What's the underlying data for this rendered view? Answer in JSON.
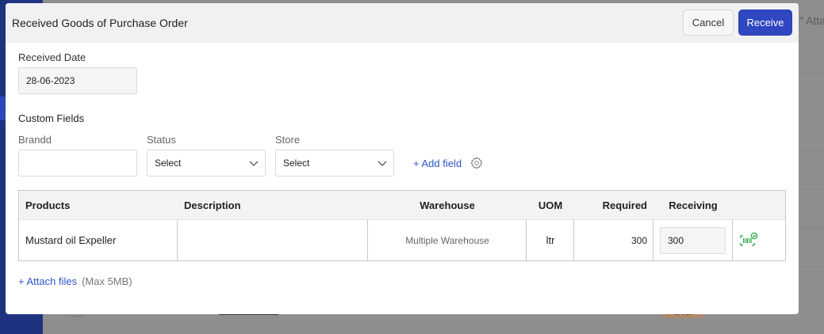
{
  "background": {
    "attach_fragment": "\" Atta",
    "partial_badge": "Partial"
  },
  "modal": {
    "title": "Received Goods of Purchase Order",
    "cancel_label": "Cancel",
    "receive_label": "Receive",
    "received_date": {
      "label": "Received Date",
      "value": "28-06-2023"
    },
    "custom_fields": {
      "title": "Custom Fields",
      "brand": {
        "label": "Brandd",
        "value": ""
      },
      "status": {
        "label": "Status",
        "value": "Select"
      },
      "store": {
        "label": "Store",
        "value": "Select"
      },
      "add_field_label": "+ Add field"
    },
    "table": {
      "headers": {
        "products": "Products",
        "description": "Description",
        "warehouse": "Warehouse",
        "uom": "UOM",
        "required": "Required",
        "receiving": "Receiving"
      },
      "rows": [
        {
          "product": "Mustard oil Expeller",
          "description": "",
          "warehouse": "Multiple Warehouse",
          "uom": "ltr",
          "required": "300",
          "receiving": "300"
        }
      ]
    },
    "attach": {
      "link_label": "+ Attach files",
      "note": "(Max 5MB)"
    }
  },
  "colors": {
    "primary": "#2f47c0",
    "link": "#2f55c8",
    "sidebar": "#1f3280",
    "scan_icon": "#27a745"
  },
  "icons": {
    "status_dropdown": "chevron-down-icon",
    "store_dropdown": "chevron-down-icon",
    "settings": "gear-icon",
    "scan": "barcode-check-icon"
  }
}
